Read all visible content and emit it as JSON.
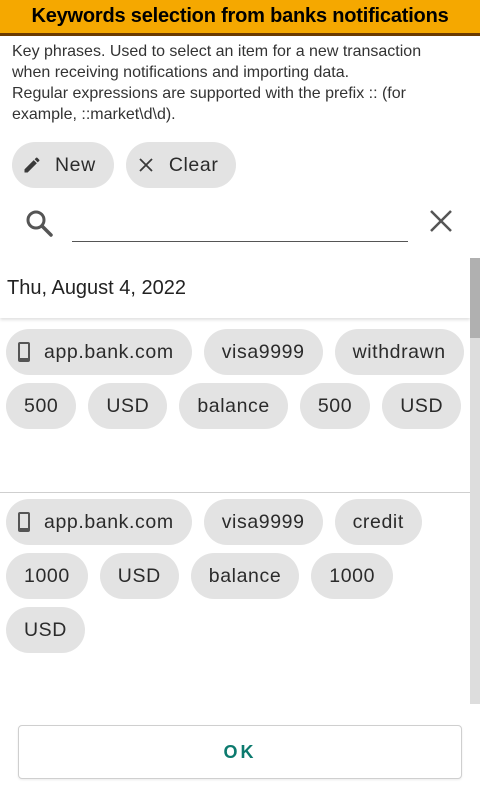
{
  "dialog": {
    "title": "Keywords selection from banks notifications",
    "description_lines": [
      "Key phrases. Used to select an item for a new transaction",
      "when receiving notifications and importing data.",
      "Regular expressions are supported with the prefix :: (for",
      "example, ::market\\d\\d)."
    ]
  },
  "actions": {
    "new_label": "New",
    "clear_label": "Clear"
  },
  "search": {
    "value": "",
    "placeholder": ""
  },
  "list": {
    "date_header": "Thu, August 4, 2022",
    "groups": [
      {
        "chips": [
          "app.bank.com",
          "visa9999",
          "withdrawn",
          "500",
          "USD",
          "balance",
          "500",
          "USD"
        ]
      },
      {
        "chips": [
          "app.bank.com",
          "visa9999",
          "credit",
          "1000",
          "USD",
          "balance",
          "1000",
          "USD"
        ]
      }
    ]
  },
  "footer": {
    "ok_label": "OK"
  },
  "colors": {
    "title_bar": "#f5a800",
    "accent": "#0c7a6e",
    "chip_bg": "#e3e3e3"
  },
  "icons": [
    "pencil-icon",
    "close-icon",
    "search-icon",
    "phone-icon"
  ]
}
